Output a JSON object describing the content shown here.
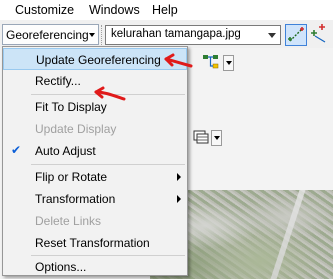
{
  "menubar": {
    "items": [
      "Customize",
      "Windows",
      "Help"
    ]
  },
  "toolbar": {
    "georeferencing_label": "Georeferencing",
    "layer_value": "kelurahan tamangapa.jpg"
  },
  "menu": {
    "items": [
      {
        "label": "Update Georeferencing",
        "enabled": true
      },
      {
        "label": "Rectify...",
        "enabled": true
      },
      {
        "label": "Fit To Display",
        "enabled": true
      },
      {
        "label": "Update Display",
        "enabled": false
      },
      {
        "label": "Auto Adjust",
        "enabled": true,
        "checked": true
      },
      {
        "label": "Flip or Rotate",
        "enabled": true,
        "submenu": true
      },
      {
        "label": "Transformation",
        "enabled": true,
        "submenu": true
      },
      {
        "label": "Delete Links",
        "enabled": false
      },
      {
        "label": "Reset Transformation",
        "enabled": true
      },
      {
        "label": "Options...",
        "enabled": true
      }
    ]
  },
  "colors": {
    "menu_highlight": "#cce4f7",
    "annotation_red": "#e01a1a",
    "disabled_text": "#a0a0a0"
  },
  "icons": [
    "dropdown-arrow",
    "add-control-points-icon",
    "control-points-icon",
    "checkmark-icon",
    "submenu-arrow-icon",
    "tree-view-icon"
  ]
}
